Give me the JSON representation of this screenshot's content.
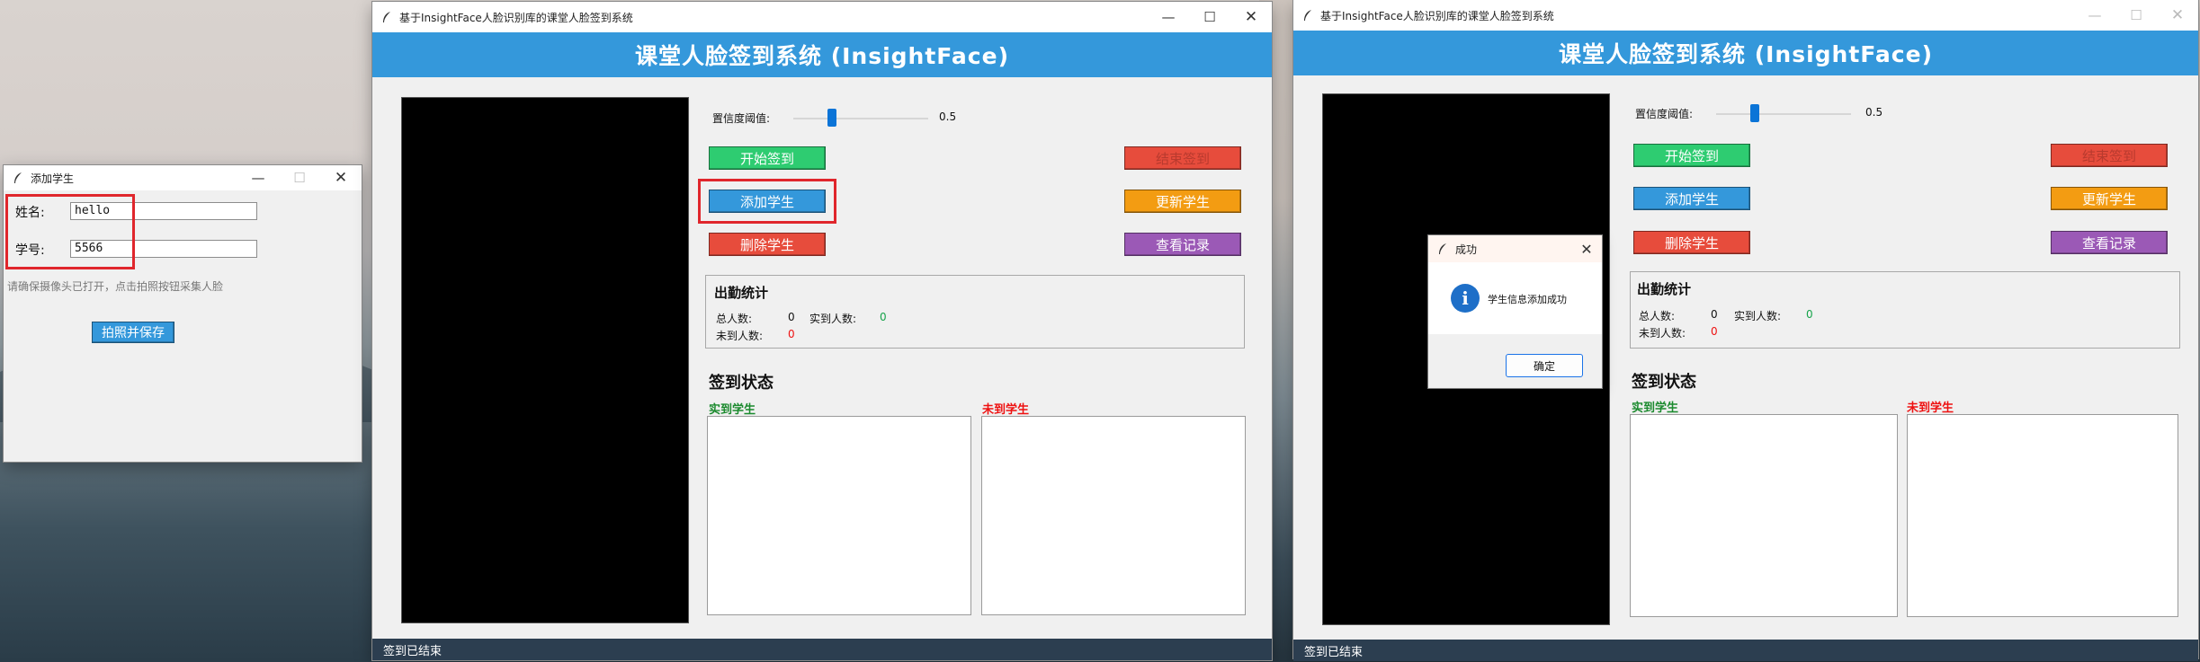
{
  "app": {
    "window_title": "基于InsightFace人脸识别库的课堂人脸签到系统",
    "banner_title": "课堂人脸签到系统 (InsightFace)",
    "threshold_label": "置信度阈值:",
    "threshold_value": "0.5",
    "buttons": {
      "start": "开始签到",
      "end": "结束签到",
      "add": "添加学生",
      "update": "更新学生",
      "delete": "删除学生",
      "records": "查看记录"
    },
    "stats": {
      "title": "出勤统计",
      "total_label": "总人数:",
      "total_value": "0",
      "present_label": "实到人数:",
      "present_value": "0",
      "absent_label": "未到人数:",
      "absent_value": "0"
    },
    "checkin": {
      "title": "签到状态",
      "present_title": "实到学生",
      "absent_title": "未到学生"
    },
    "status_text": "签到已结束"
  },
  "add_dialog": {
    "title": "添加学生",
    "name_label": "姓名:",
    "name_value": "hello",
    "id_label": "学号:",
    "id_value": "5566",
    "hint": "请确保摄像头已打开，点击拍照按钮采集人脸",
    "capture_button": "拍照并保存"
  },
  "success_dialog": {
    "title": "成功",
    "message": "学生信息添加成功",
    "ok_button": "确定"
  },
  "colors": {
    "banner": "#3498db",
    "green": "#2ecc71",
    "red": "#e74c3c",
    "blue": "#3498db",
    "orange": "#f39c12",
    "purple": "#9b59b6",
    "status_bar": "#2c3e50",
    "highlight": "#e0262c"
  },
  "icons": {
    "window": "feather-icon",
    "minimize": "minimize-icon",
    "maximize": "maximize-icon",
    "close": "close-icon",
    "info": "info-icon"
  }
}
